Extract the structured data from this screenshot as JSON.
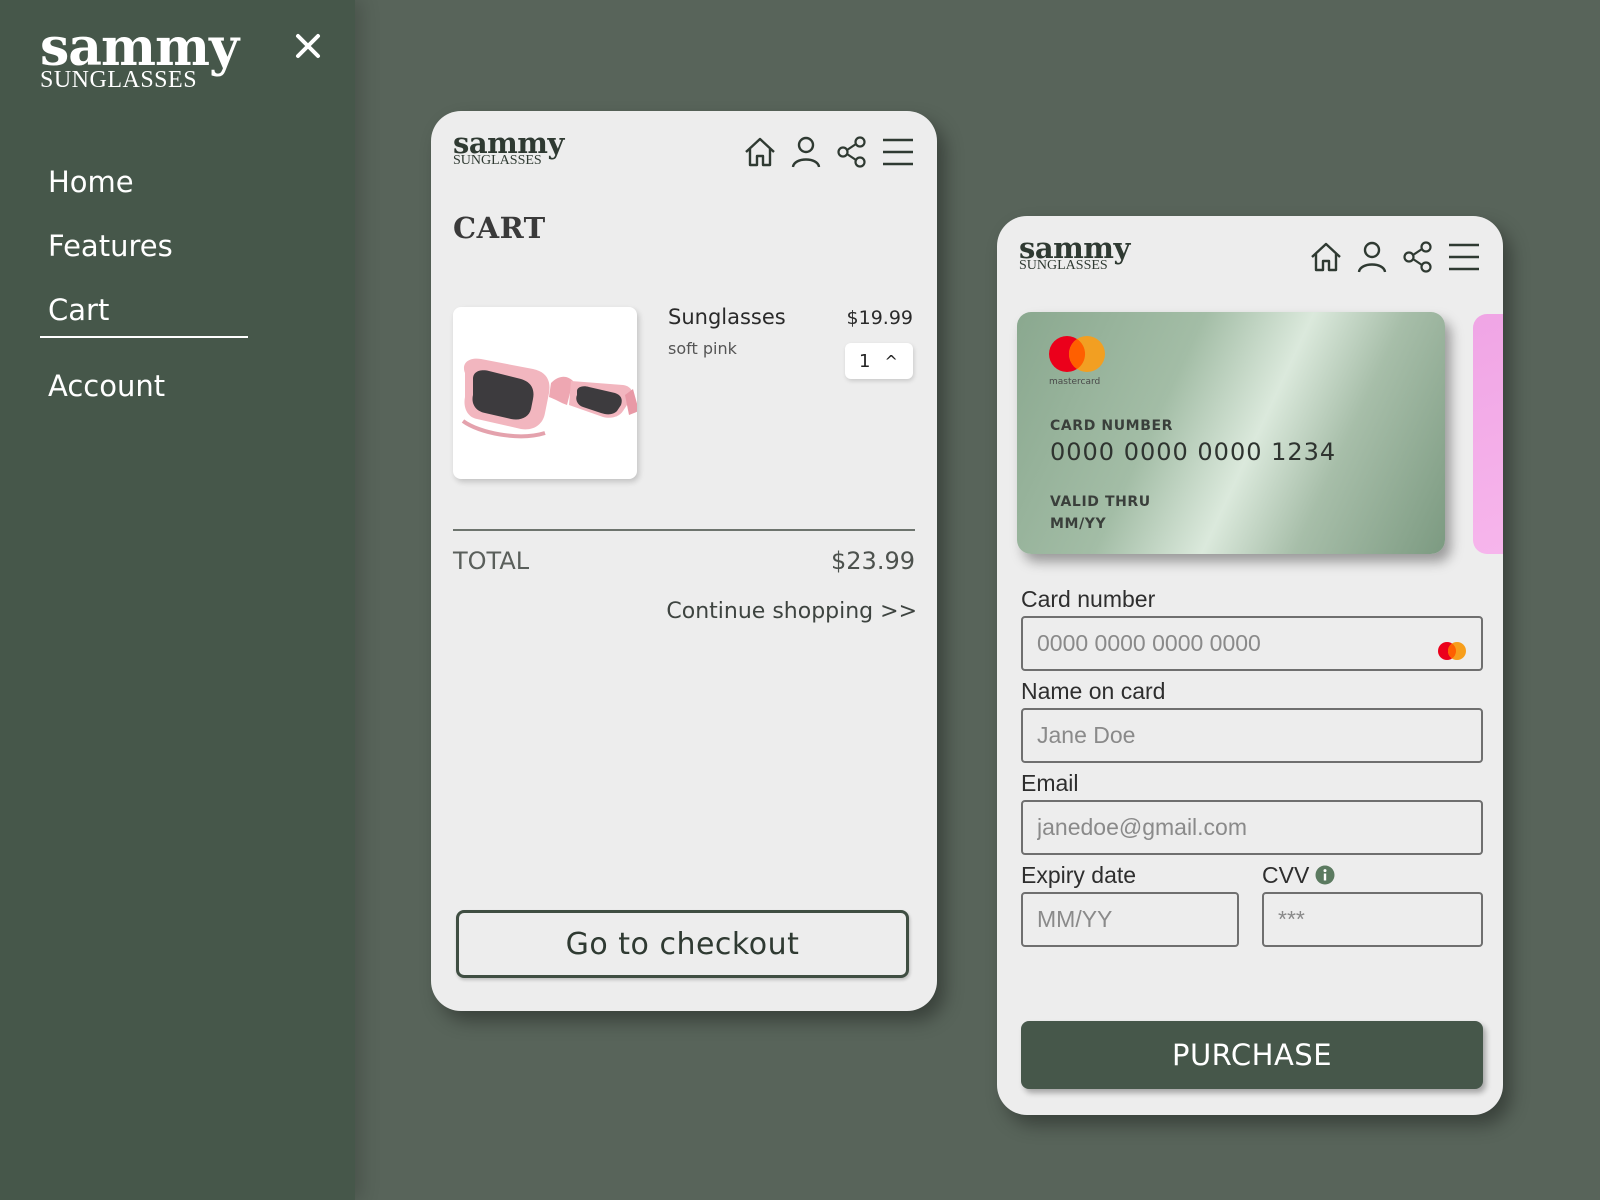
{
  "sidebar": {
    "brand_word": "sammy",
    "brand_sub": "SUNGLASSES",
    "close_icon": "close-icon",
    "items": [
      {
        "label": "Home"
      },
      {
        "label": "Features"
      },
      {
        "label": "Cart",
        "active": true
      },
      {
        "label": "Account"
      }
    ]
  },
  "header": {
    "brand_word": "sammy",
    "brand_sub": "SUNGLASSES",
    "icons": [
      "home-icon",
      "user-icon",
      "share-icon",
      "menu-icon"
    ]
  },
  "cart": {
    "title": "CART",
    "item": {
      "name": "Sunglasses",
      "variant": "soft pink",
      "price": "$19.99",
      "quantity": "1",
      "qty_up": "^"
    },
    "total_label": "TOTAL",
    "total_value": "$23.99",
    "continue_label": "Continue shopping >>",
    "checkout_label": "Go to checkout"
  },
  "payment": {
    "card": {
      "brand": "mastercard",
      "number_label": "CARD NUMBER",
      "number": "0000 0000 0000 1234",
      "valid_label": "VALID THRU",
      "valid_value": "MM/YY"
    },
    "form": {
      "card_number_label": "Card number",
      "card_number_placeholder": "0000 0000 0000 0000",
      "name_label": "Name on card",
      "name_placeholder": "Jane Doe",
      "email_label": "Email",
      "email_placeholder": "janedoe@gmail.com",
      "expiry_label": "Expiry date",
      "expiry_placeholder": "MM/YY",
      "cvv_label": "CVV",
      "cvv_placeholder": "***"
    },
    "purchase_label": "PURCHASE"
  },
  "colors": {
    "background": "#58645a",
    "sidebar": "#46574a",
    "accent": "#46574a",
    "card_pink": "#f7b6ec"
  }
}
